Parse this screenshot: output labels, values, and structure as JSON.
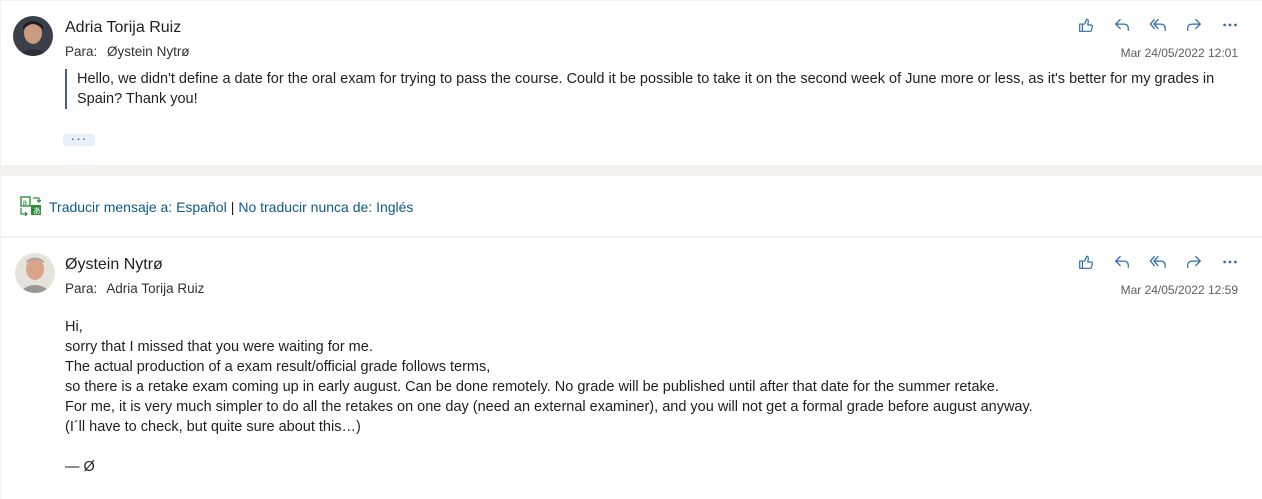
{
  "message1": {
    "sender": "Adria Torija Ruiz",
    "to_label": "Para:",
    "to_name": "Øystein Nytrø",
    "date": "Mar 24/05/2022 12:01",
    "body": "Hello, we didn't define a date for the oral exam for trying to pass the course. Could it be possible to take it on the second week of June more or less, as it's better for my grades in Spain? Thank you!",
    "more": "···"
  },
  "translation": {
    "translate_link": "Traducir mensaje a: Español",
    "separator": "|",
    "never_link": "No traducir nunca de: Inglés"
  },
  "message2": {
    "sender": "Øystein Nytrø",
    "to_label": "Para:",
    "to_name": "Adria Torija Ruiz",
    "date": "Mar 24/05/2022 12:59",
    "body_lines": [
      "Hi,",
      "sorry that I missed that you were waiting for me.",
      "The actual production of a exam result/official grade follows terms,",
      "so there is a retake exam coming up in early august. Can be done remotely. No grade will be published until after that date for the summer retake.",
      "For me, it is very much simpler to do all the retakes on one day (need an external examiner), and you will not get a formal grade before august anyway.",
      "(I´ll have to check, but quite sure about this…)",
      "",
      "— Ø"
    ]
  },
  "icons": [
    "like-icon",
    "reply-icon",
    "reply-all-icon",
    "forward-icon",
    "more-icon",
    "translate-icon"
  ],
  "colors": {
    "accent": "#2b6cb0",
    "link": "#0f5a8f",
    "translate_icon": "#2e8b3a"
  }
}
